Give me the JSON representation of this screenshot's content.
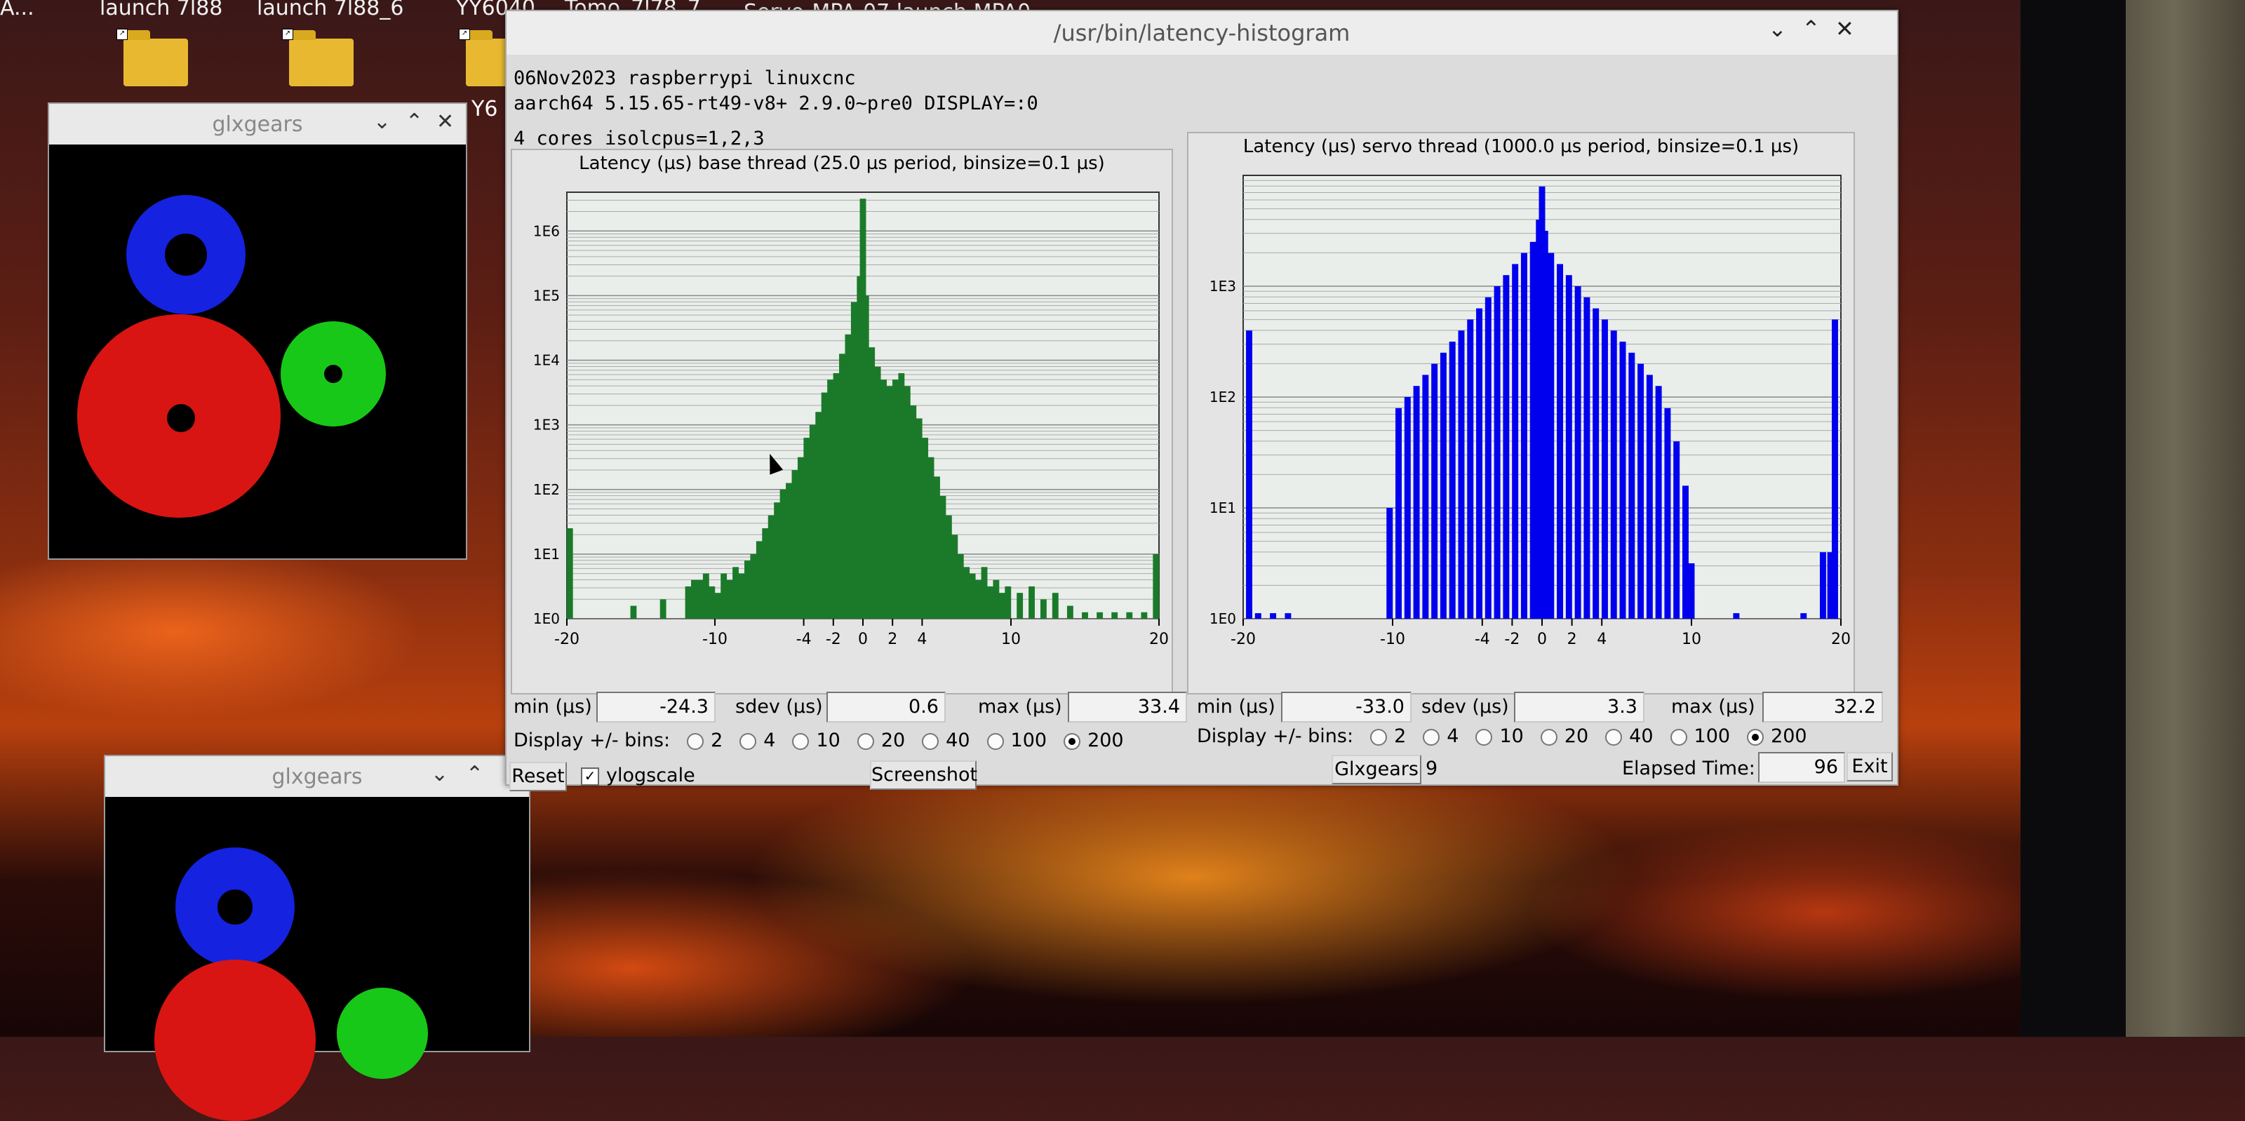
{
  "desktop": {
    "labels": [
      {
        "text": "A...",
        "x": 0
      },
      {
        "text": "launch 7l88",
        "x": 140
      },
      {
        "text": "launch 7l88_6",
        "x": 366
      },
      {
        "text": "YY6040",
        "x": 650
      },
      {
        "text": "Tomo_7l78_7...",
        "x": 800
      }
    ],
    "behind_title": "Servo-MPA-07 launch MPA0...",
    "partial_label": "Y6"
  },
  "glx_top": {
    "title": "glxgears"
  },
  "glx_bottom": {
    "title": "glxgears"
  },
  "window": {
    "title": "/usr/bin/latency-histogram",
    "info_line1": "06Nov2023 raspberrypi linuxcnc",
    "info_line2": "aarch64  5.15.65-rt49-v8+  2.9.0~pre0  DISPLAY=:0",
    "info_line3": "4 cores  isolcpus=1,2,3"
  },
  "chart_data": [
    {
      "type": "bar",
      "title": "Latency (µs) base thread (25.0 µs period, binsize=0.1 µs)",
      "color": "#1b7a2a",
      "log_y": true,
      "y_ticks": [
        "1E0",
        "1E1",
        "1E2",
        "1E3",
        "1E4",
        "1E5",
        "1E6"
      ],
      "x_ticks": [
        "-20",
        "-10",
        "-4",
        "-2",
        "0",
        "2",
        "4",
        "10",
        "20"
      ],
      "xlim": [
        -20,
        20
      ],
      "ylim_log10": [
        0,
        6.6
      ],
      "series": [
        {
          "x": [
            -19.8,
            -15.5,
            -13.5,
            -11.8,
            -11.4,
            -11.0,
            -10.6,
            -10.2,
            -9.8,
            -9.4,
            -9.0,
            -8.6,
            -8.2,
            -7.8,
            -7.4,
            -7.0,
            -6.6,
            -6.2,
            -5.8,
            -5.4,
            -5.0,
            -4.6,
            -4.2,
            -3.8,
            -3.4,
            -3.0,
            -2.6,
            -2.2,
            -1.8,
            -1.4,
            -1.0,
            -0.6,
            -0.2,
            0.0,
            0.2,
            0.6,
            1.0,
            1.4,
            1.8,
            2.2,
            2.6,
            3.0,
            3.4,
            3.8,
            4.2,
            4.6,
            5.0,
            5.4,
            5.8,
            6.2,
            6.6,
            7.0,
            7.4,
            7.8,
            8.2,
            8.6,
            9.0,
            9.4,
            9.8,
            10.6,
            11.4,
            12.2,
            13.0,
            14.0,
            15.0,
            16.0,
            17.0,
            18.0,
            19.0,
            19.8
          ],
          "y": [
            1.4,
            0.2,
            0.3,
            0.5,
            0.6,
            0.6,
            0.7,
            0.5,
            0.4,
            0.7,
            0.6,
            0.8,
            0.7,
            0.9,
            1.0,
            1.2,
            1.4,
            1.6,
            1.8,
            2.0,
            2.1,
            2.3,
            2.5,
            2.8,
            3.0,
            3.2,
            3.5,
            3.7,
            3.8,
            4.1,
            4.4,
            4.9,
            5.3,
            6.5,
            5.0,
            4.2,
            3.9,
            3.7,
            3.6,
            3.7,
            3.8,
            3.6,
            3.3,
            3.1,
            2.8,
            2.5,
            2.2,
            1.9,
            1.6,
            1.3,
            1.0,
            0.8,
            0.7,
            0.6,
            0.8,
            0.5,
            0.6,
            0.4,
            0.5,
            0.4,
            0.5,
            0.3,
            0.4,
            0.2,
            0.1,
            0.1,
            0.1,
            0.1,
            0.1,
            1.0
          ]
        }
      ],
      "stats": {
        "min_label": "min (µs)",
        "min": "-24.3",
        "sdev_label": "sdev (µs)",
        "sdev": "0.6",
        "max_label": "max (µs)",
        "max": "33.4"
      },
      "bins_label": "Display +/- bins:",
      "bins_options": [
        "2",
        "4",
        "10",
        "20",
        "40",
        "100",
        "200"
      ],
      "bins_selected": "200"
    },
    {
      "type": "bar",
      "title": "Latency (µs) servo thread (1000.0 µs period, binsize=0.1 µs)",
      "color": "#0000ee",
      "log_y": true,
      "y_ticks": [
        "1E0",
        "1E1",
        "1E2",
        "1E3"
      ],
      "x_ticks": [
        "-20",
        "-10",
        "-4",
        "-2",
        "0",
        "2",
        "4",
        "10",
        "20"
      ],
      "xlim": [
        -20,
        20
      ],
      "ylim_log10": [
        0,
        4.0
      ],
      "series": [
        {
          "x": [
            -19.6,
            -19.0,
            -18.0,
            -17.0,
            -10.2,
            -9.6,
            -9.0,
            -8.4,
            -7.8,
            -7.2,
            -6.6,
            -6.0,
            -5.4,
            -4.8,
            -4.2,
            -3.6,
            -3.0,
            -2.4,
            -1.8,
            -1.2,
            -0.6,
            -0.2,
            0.0,
            0.2,
            0.6,
            1.2,
            1.8,
            2.4,
            3.0,
            3.6,
            4.2,
            4.8,
            5.4,
            6.0,
            6.6,
            7.2,
            7.8,
            8.4,
            9.0,
            9.6,
            10.0,
            13.0,
            17.5,
            18.8,
            19.3,
            19.6
          ],
          "y": [
            2.6,
            0.05,
            0.05,
            0.05,
            1.0,
            1.9,
            2.0,
            2.1,
            2.2,
            2.3,
            2.4,
            2.5,
            2.6,
            2.7,
            2.8,
            2.9,
            3.0,
            3.1,
            3.2,
            3.3,
            3.4,
            3.6,
            3.9,
            3.5,
            3.3,
            3.2,
            3.1,
            3.0,
            2.9,
            2.8,
            2.7,
            2.6,
            2.5,
            2.4,
            2.3,
            2.2,
            2.1,
            1.9,
            1.6,
            1.2,
            0.5,
            0.05,
            0.05,
            0.6,
            0.6,
            2.7
          ]
        }
      ],
      "stats": {
        "min_label": "min (µs)",
        "min": "-33.0",
        "sdev_label": "sdev (µs)",
        "sdev": "3.3",
        "max_label": "max (µs)",
        "max": "32.2"
      },
      "bins_label": "Display +/- bins:",
      "bins_options": [
        "2",
        "4",
        "10",
        "20",
        "40",
        "100",
        "200"
      ],
      "bins_selected": "200"
    }
  ],
  "bottom_bar": {
    "reset": "Reset",
    "ylogscale": "ylogscale",
    "screenshot": "Screenshot",
    "glxgears": "Glxgears",
    "glxgears_count": "9",
    "elapsed_label": "Elapsed Time:",
    "elapsed_value": "96",
    "exit": "Exit"
  }
}
